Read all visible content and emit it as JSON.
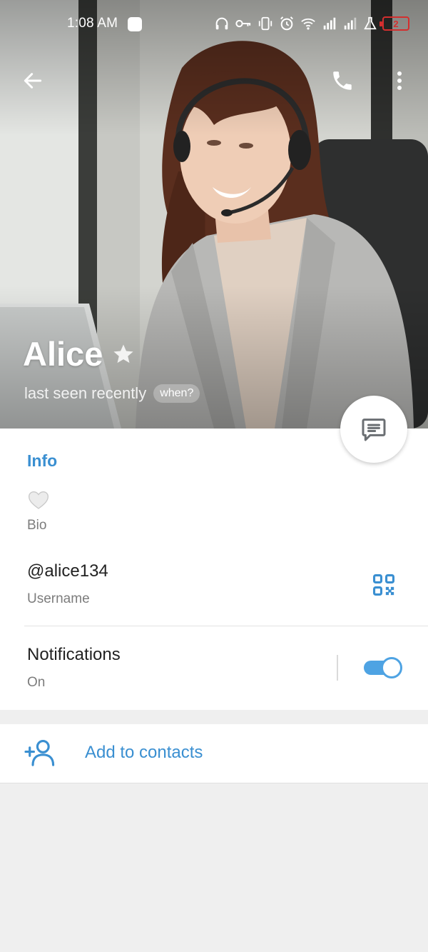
{
  "status_bar": {
    "time": "1:08 AM",
    "battery_level": "2",
    "icons": [
      "headphones-icon",
      "vpn-key-icon",
      "vibrate-icon",
      "alarm-icon",
      "wifi-icon",
      "signal-icon",
      "signal-icon",
      "lab-flask-icon"
    ]
  },
  "toolbar": {
    "back_icon": "arrow-left-icon",
    "call_icon": "phone-icon",
    "more_icon": "more-vertical-icon"
  },
  "profile": {
    "name": "Alice",
    "last_seen": "last seen recently",
    "when_chip": "when?"
  },
  "info": {
    "section_title": "Info",
    "bio_label": "Bio",
    "username": "@alice134",
    "username_label": "Username",
    "notifications_title": "Notifications",
    "notifications_value": "On",
    "notifications_enabled": true
  },
  "actions": {
    "add_contact_label": "Add to contacts"
  },
  "colors": {
    "accent": "#3a8fd1",
    "toggle_on": "#4ea3e3",
    "battery_low": "#d32f2f",
    "page_background": "#efefef"
  }
}
